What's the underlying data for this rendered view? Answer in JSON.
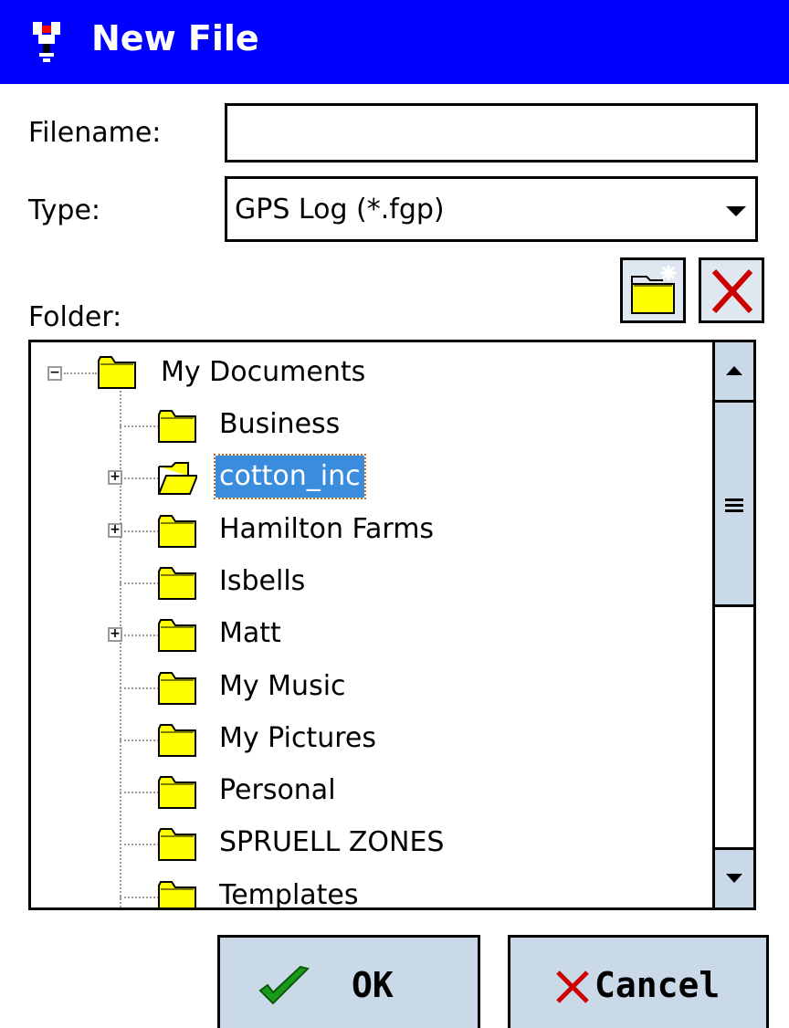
{
  "window": {
    "title": "New File",
    "icon": "app-gps-icon"
  },
  "form": {
    "filename_label": "Filename:",
    "filename_value": "",
    "type_label": "Type:",
    "type_value": "GPS Log (*.fgp)",
    "folder_label": "Folder:"
  },
  "toolbar": {
    "new_folder_icon": "new-folder-icon",
    "delete_icon": "delete-icon"
  },
  "tree": {
    "root": "My Documents",
    "items": [
      {
        "label": "Business",
        "expandable": false,
        "selected": false
      },
      {
        "label": "cotton_inc",
        "expandable": true,
        "selected": true
      },
      {
        "label": "Hamilton Farms",
        "expandable": true,
        "selected": false
      },
      {
        "label": "Isbells",
        "expandable": false,
        "selected": false
      },
      {
        "label": "Matt",
        "expandable": true,
        "selected": false
      },
      {
        "label": "My Music",
        "expandable": false,
        "selected": false
      },
      {
        "label": "My Pictures",
        "expandable": false,
        "selected": false
      },
      {
        "label": "Personal",
        "expandable": false,
        "selected": false
      },
      {
        "label": "SPRUELL ZONES",
        "expandable": false,
        "selected": false
      },
      {
        "label": "Templates",
        "expandable": false,
        "selected": false
      }
    ]
  },
  "buttons": {
    "ok": "OK",
    "cancel": "Cancel"
  },
  "colors": {
    "titlebar": "#0000ff",
    "selection": "#3a8ddc",
    "button_face": "#c9d9e8",
    "folder": "#ffff00"
  }
}
